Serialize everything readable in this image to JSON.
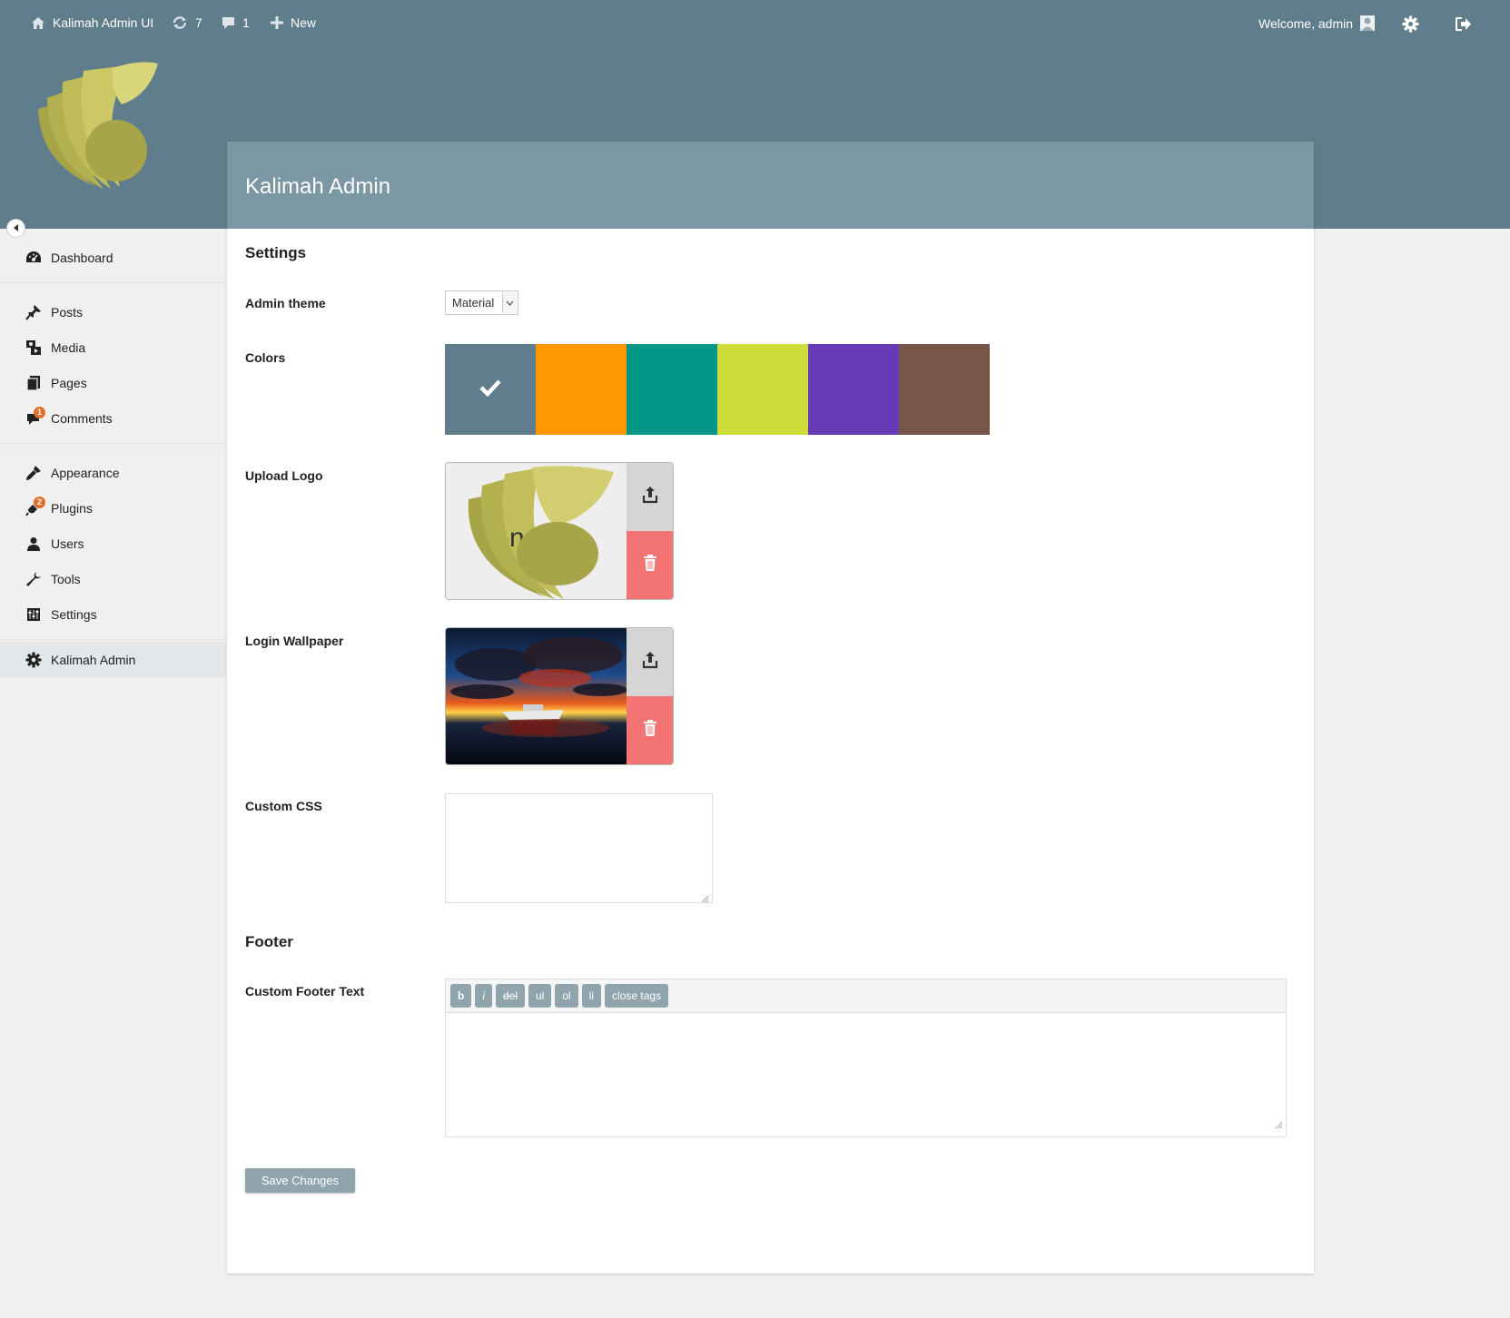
{
  "topbar": {
    "site_name": "Kalimah Admin UI",
    "updates_count": "7",
    "comments_count": "1",
    "new_label": "New",
    "welcome_text": "Welcome, admin"
  },
  "sidebar": {
    "items": [
      {
        "label": "Dashboard",
        "icon": "dashboard-icon"
      },
      {
        "label": "Posts",
        "icon": "pin-icon"
      },
      {
        "label": "Media",
        "icon": "media-icon"
      },
      {
        "label": "Pages",
        "icon": "pages-icon"
      },
      {
        "label": "Comments",
        "icon": "comment-icon",
        "badge": "1"
      },
      {
        "label": "Appearance",
        "icon": "brush-icon"
      },
      {
        "label": "Plugins",
        "icon": "plugin-icon",
        "badge": "2"
      },
      {
        "label": "Users",
        "icon": "user-icon"
      },
      {
        "label": "Tools",
        "icon": "wrench-icon"
      },
      {
        "label": "Settings",
        "icon": "settings-icon"
      },
      {
        "label": "Kalimah Admin",
        "icon": "gear-icon"
      }
    ]
  },
  "page": {
    "title": "Kalimah Admin",
    "settings_heading": "Settings",
    "admin_theme_label": "Admin theme",
    "admin_theme_value": "Material",
    "colors_label": "Colors",
    "colors": [
      "#607d8b",
      "#ff9800",
      "#009688",
      "#cddc39",
      "#673ab7",
      "#795548"
    ],
    "selected_color_index": 0,
    "upload_logo_label": "Upload Logo",
    "login_wallpaper_label": "Login Wallpaper",
    "custom_css_label": "Custom CSS",
    "custom_css_value": "",
    "footer_heading": "Footer",
    "custom_footer_label": "Custom Footer Text",
    "footer_value": "",
    "quicktags": [
      "b",
      "i",
      "del",
      "ul",
      "ol",
      "li",
      "close tags"
    ],
    "save_label": "Save Changes"
  }
}
